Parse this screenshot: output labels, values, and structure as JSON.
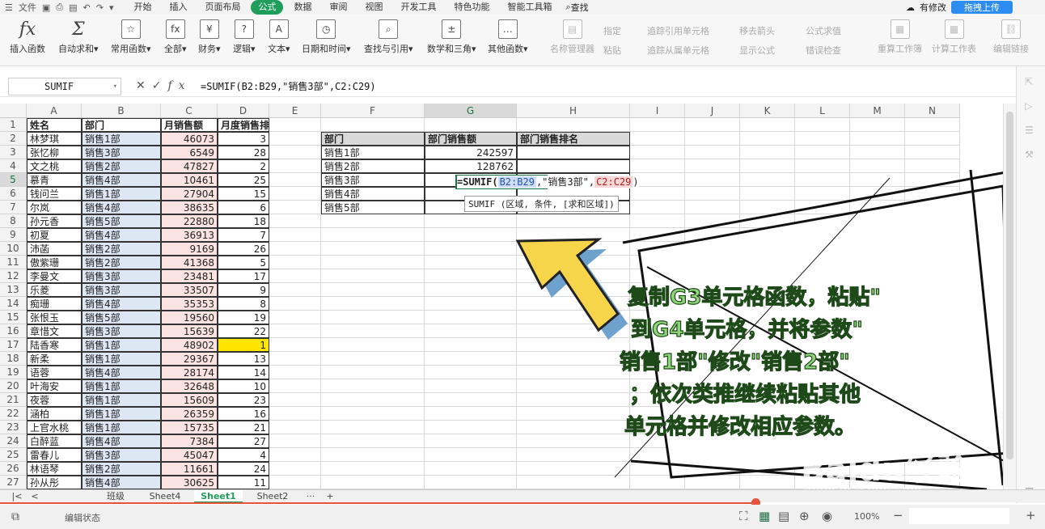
{
  "menubar": {
    "file": "文件",
    "tabs": [
      "开始",
      "插入",
      "页面布局",
      "公式",
      "数据",
      "审阅",
      "视图",
      "开发工具",
      "特色功能",
      "智能工具箱"
    ],
    "active_tab": "公式",
    "search": "查找",
    "right_text": "有修改",
    "upload": "拖拽上传"
  },
  "ribbon": {
    "main": [
      "插入函数",
      "自动求和",
      "常用函数",
      "全部",
      "财务",
      "逻辑",
      "文本",
      "日期和时间",
      "查找与引用",
      "数学和三角",
      "其他函数"
    ],
    "dim": [
      "名称管理器",
      "重算工作簿",
      "计算工作表",
      "编辑链接"
    ],
    "small": [
      "指定",
      "粘贴",
      "追踪引用单元格",
      "追踪从属单元格",
      "移去箭头",
      "显示公式",
      "公式求值",
      "错误检查"
    ]
  },
  "formula_bar": {
    "name_box": "SUMIF",
    "formula": "=SUMIF(B2:B29,\"销售3部\",C2:C29)"
  },
  "columns": [
    "A",
    "B",
    "C",
    "D",
    "E",
    "F",
    "G",
    "H",
    "I",
    "J",
    "K",
    "L",
    "M",
    "N"
  ],
  "table1": {
    "headers": [
      "姓名",
      "部门",
      "月销售额",
      "月度销售排名"
    ],
    "rows": [
      [
        "林梦琪",
        "销售1部",
        "46073",
        "3"
      ],
      [
        "张忆柳",
        "销售3部",
        "6549",
        "28"
      ],
      [
        "文之桃",
        "销售2部",
        "47827",
        "2"
      ],
      [
        "慕青",
        "销售4部",
        "10461",
        "25"
      ],
      [
        "钱问兰",
        "销售1部",
        "27904",
        "15"
      ],
      [
        "尔岚",
        "销售4部",
        "38635",
        "6"
      ],
      [
        "孙元香",
        "销售5部",
        "22880",
        "18"
      ],
      [
        "初夏",
        "销售4部",
        "36913",
        "7"
      ],
      [
        "沛菡",
        "销售2部",
        "9169",
        "26"
      ],
      [
        "傲紫珊",
        "销售2部",
        "41368",
        "5"
      ],
      [
        "李曼文",
        "销售3部",
        "23481",
        "17"
      ],
      [
        "乐菱",
        "销售3部",
        "33507",
        "9"
      ],
      [
        "痴珊",
        "销售4部",
        "35353",
        "8"
      ],
      [
        "张恨玉",
        "销售5部",
        "19560",
        "19"
      ],
      [
        "章惜文",
        "销售3部",
        "15639",
        "22"
      ],
      [
        "陆香寒",
        "销售1部",
        "48902",
        "1"
      ],
      [
        "新柔",
        "销售1部",
        "29367",
        "13"
      ],
      [
        "语蓉",
        "销售4部",
        "28174",
        "14"
      ],
      [
        "叶海安",
        "销售1部",
        "32648",
        "10"
      ],
      [
        "夜蓉",
        "销售1部",
        "15609",
        "23"
      ],
      [
        "涵柏",
        "销售1部",
        "26359",
        "16"
      ],
      [
        "上官水桃",
        "销售1部",
        "15735",
        "21"
      ],
      [
        "白醉蓝",
        "销售4部",
        "7384",
        "27"
      ],
      [
        "雷春儿",
        "销售3部",
        "45047",
        "4"
      ],
      [
        "林语琴",
        "销售2部",
        "11661",
        "24"
      ],
      [
        "孙从彤",
        "销售4部",
        "30625",
        "11"
      ]
    ]
  },
  "table2": {
    "headers": [
      "部门",
      "部门销售额",
      "部门销售排名"
    ],
    "rows": [
      [
        "销售1部",
        "242597",
        ""
      ],
      [
        "销售2部",
        "128762",
        ""
      ],
      [
        "销售3部",
        "",
        ""
      ],
      [
        "销售4部",
        "",
        ""
      ],
      [
        "销售5部",
        "",
        ""
      ]
    ]
  },
  "editor": {
    "prefix": "=SUMIF(",
    "ref1": "B2:B29",
    "mid": ",\"销售3部\",",
    "ref2": "C2:C29",
    "suffix": ")",
    "tooltip": "SUMIF (区域, 条件, [求和区域])"
  },
  "sheet_tabs": [
    "班级",
    "Sheet4",
    "Sheet1",
    "Sheet2"
  ],
  "active_sheet": "Sheet1",
  "status": {
    "mode": "编辑状态",
    "zoom": "100%"
  },
  "callout": {
    "lines": [
      "复制G3单元格函数，粘贴\"",
      "到G4单元格，并将参数\"",
      "销售1部\"修改\"销售2部\"",
      "；依次类推继续粘贴其他",
      "单元格并修改相应参数。"
    ]
  },
  "watermark": {
    "brand": "Baidu经验",
    "url": "jingyan.baidu.com"
  }
}
